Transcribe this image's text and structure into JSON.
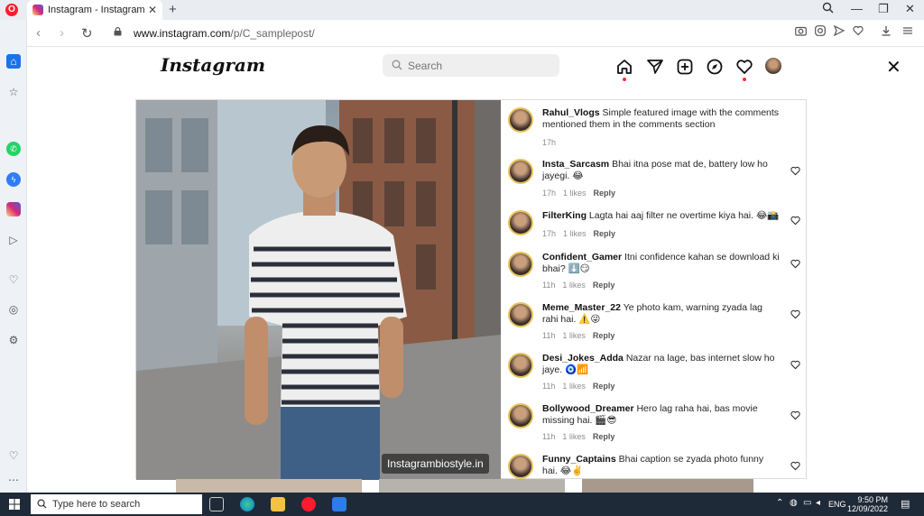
{
  "browser": {
    "tab_title": "Instagram - Instagram",
    "url_host": "www.instagram.com",
    "url_path": "/p/C_samplepost/"
  },
  "instagram": {
    "logo": "Instagram",
    "search_placeholder": "Search",
    "watermark": "Instagrambiostyle.in",
    "comments": [
      {
        "user": "Rahul_Vlogs",
        "text": "Simple featured image with the comments mentioned them in the comments section",
        "time": "17h",
        "likes": "",
        "reply": ""
      },
      {
        "user": "Insta_Sarcasm",
        "text": "Bhai itna pose mat de, battery low ho jayegi. 😂",
        "time": "17h",
        "likes": "1 likes",
        "reply": "Reply"
      },
      {
        "user": "FilterKing",
        "text": "Lagta hai aaj filter ne overtime kiya hai. 😂📸",
        "time": "17h",
        "likes": "1 likes",
        "reply": "Reply"
      },
      {
        "user": "Confident_Gamer",
        "text": "Itni confidence kahan se download ki bhai? ⬇️😏",
        "time": "11h",
        "likes": "1 likes",
        "reply": "Reply"
      },
      {
        "user": "Meme_Master_22",
        "text": "Ye photo kam, warning zyada lag rahi hai. ⚠️😜",
        "time": "11h",
        "likes": "1 likes",
        "reply": "Reply"
      },
      {
        "user": "Desi_Jokes_Adda",
        "text": "Nazar na lage, bas internet slow ho jaye. 🧿📶",
        "time": "11h",
        "likes": "1 likes",
        "reply": "Reply"
      },
      {
        "user": "Bollywood_Dreamer",
        "text": "Hero lag raha hai, bas movie missing hai. 🎬😎",
        "time": "11h",
        "likes": "1 likes",
        "reply": "Reply"
      },
      {
        "user": "Funny_Captains",
        "text": "Bhai caption se zyada photo funny hai. 😂✌️",
        "time": "",
        "likes": "",
        "reply": ""
      }
    ]
  },
  "taskbar": {
    "search_placeholder": "Type here to search",
    "lang": "ENG",
    "time": "9:50 PM",
    "date": "12/09/2022"
  },
  "colors": {
    "accent_red": "#ff3040",
    "opera_red": "#ff1b2d",
    "taskbar": "#1f2a38"
  }
}
